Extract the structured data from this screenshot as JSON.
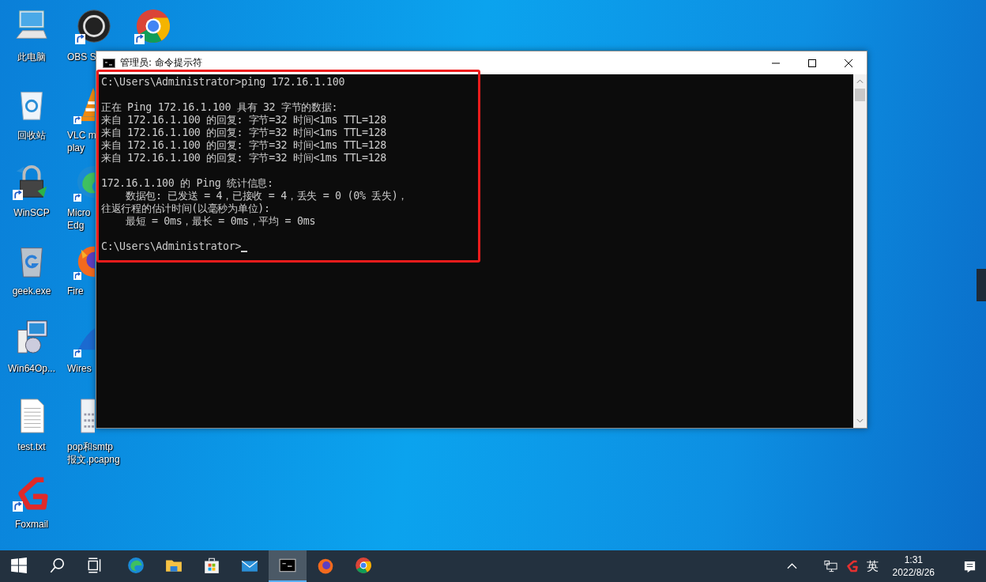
{
  "desktop": {
    "columns": [
      [
        {
          "kind": "computer",
          "label": [
            "此电脑"
          ],
          "shortcut": false
        },
        {
          "kind": "recycle-bin",
          "label": [
            "回收站"
          ],
          "shortcut": false
        },
        {
          "kind": "padlock",
          "label": [
            "WinSCP"
          ],
          "shortcut": true
        },
        {
          "kind": "trash-g",
          "label": [
            "geek.exe"
          ],
          "shortcut": false
        },
        {
          "kind": "installer",
          "label": [
            "Win64Op..."
          ],
          "shortcut": false
        },
        {
          "kind": "text-file",
          "label": [
            "test.txt"
          ],
          "shortcut": false
        },
        {
          "kind": "red-g",
          "label": [
            "Foxmail"
          ],
          "shortcut": true
        }
      ],
      [
        {
          "kind": "obs",
          "label": [
            "OBS S"
          ],
          "shortcut": true
        },
        {
          "kind": "cone",
          "label": [
            "VLC m",
            "play"
          ],
          "shortcut": true
        },
        {
          "kind": "edge",
          "label": [
            "Micro",
            "Edg"
          ],
          "shortcut": true
        },
        {
          "kind": "firefox",
          "label": [
            "Fire"
          ],
          "shortcut": true
        },
        {
          "kind": "shark",
          "label": [
            "Wires"
          ],
          "shortcut": true
        },
        {
          "kind": "binary-file",
          "label": [
            "pop和smtp",
            "报文.pcapng"
          ],
          "shortcut": false
        }
      ],
      [
        {
          "kind": "chrome",
          "shortcut": true
        }
      ]
    ]
  },
  "window": {
    "title": "管理员: 命令提示符",
    "blocks": [
      [
        "C:\\Users\\Administrator>ping 172.16.1.100"
      ],
      [
        "正在 Ping 172.16.1.100 具有 32 字节的数据:",
        "来自 172.16.1.100 的回复: 字节=32 时间<1ms TTL=128",
        "来自 172.16.1.100 的回复: 字节=32 时间<1ms TTL=128",
        "来自 172.16.1.100 的回复: 字节=32 时间<1ms TTL=128",
        "来自 172.16.1.100 的回复: 字节=32 时间<1ms TTL=128"
      ],
      [
        "172.16.1.100 的 Ping 统计信息:",
        "    数据包: 已发送 = 4，已接收 = 4，丢失 = 0 (0% 丢失)，",
        "往返行程的估计时间(以毫秒为单位):",
        "    最短 = 0ms，最长 = 0ms，平均 = 0ms"
      ],
      [
        "C:\\Users\\Administrator>"
      ]
    ],
    "cursor": true,
    "highlight": true
  },
  "taskbar": {
    "items": [
      {
        "kind": "start",
        "selected": false
      },
      {
        "kind": "search",
        "selected": false
      },
      {
        "kind": "task-view",
        "selected": false
      },
      {
        "kind": "edge",
        "selected": false
      },
      {
        "kind": "folder",
        "selected": false
      },
      {
        "kind": "store",
        "selected": false
      },
      {
        "kind": "mail",
        "selected": false
      },
      {
        "kind": "terminal",
        "selected": true
      },
      {
        "kind": "firefox",
        "selected": false
      },
      {
        "kind": "chrome",
        "selected": false
      }
    ],
    "input_method": "英",
    "time": "1:31",
    "date": "2022/8/26"
  }
}
